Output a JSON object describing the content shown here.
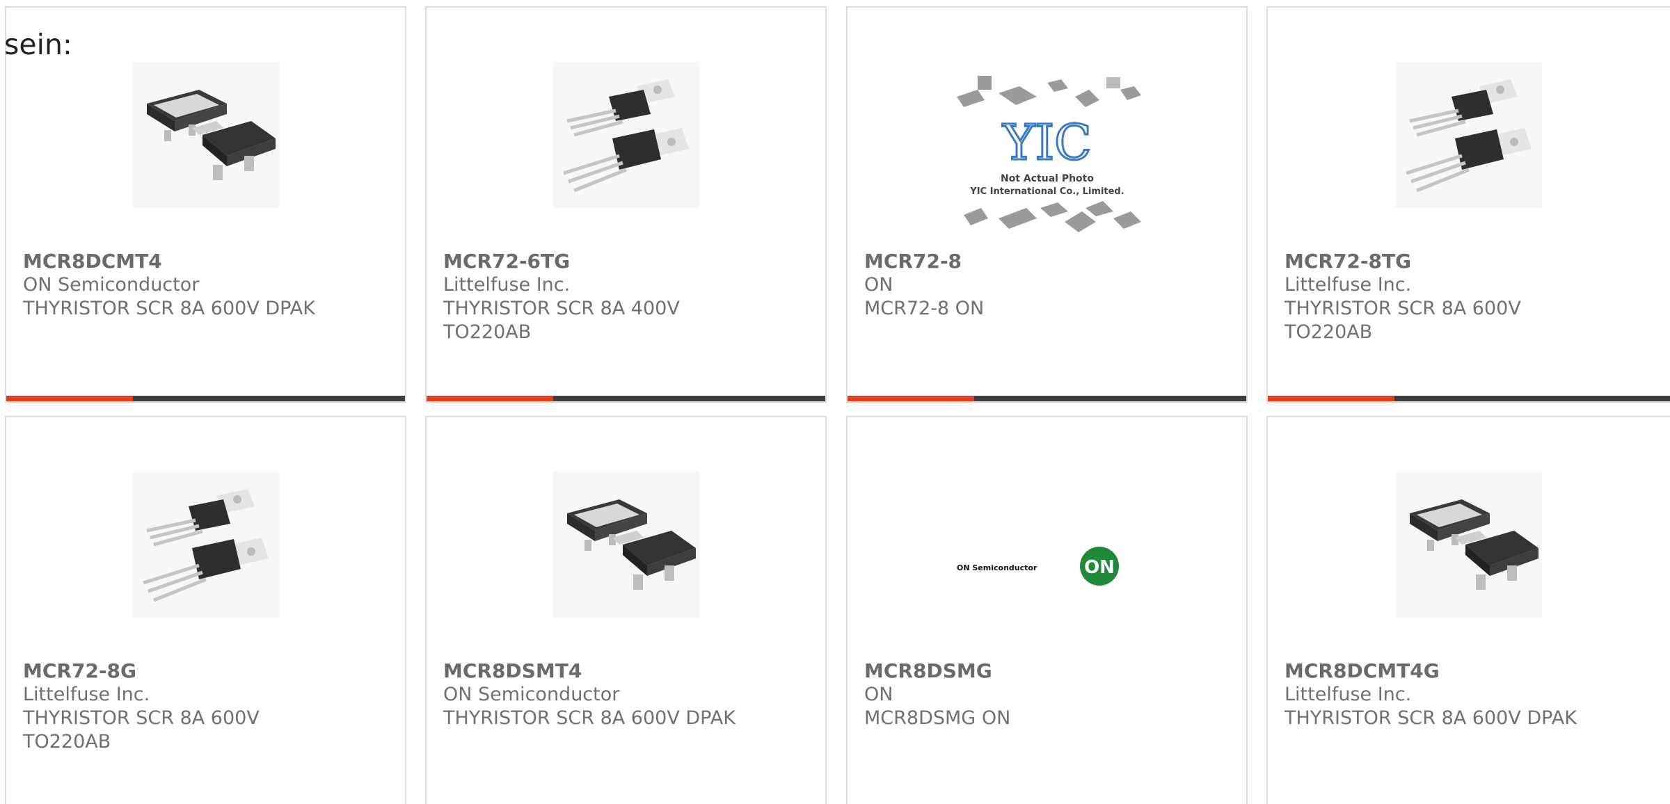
{
  "intro_text": "sein:",
  "accent_color": "#e0401c",
  "bar_color": "#3e3e3e",
  "products": [
    {
      "part_number": "MCR8DCMT4",
      "manufacturer": "ON Semiconductor",
      "description": "THYRISTOR SCR 8A 600V DPAK",
      "image": "dpak-package-icon"
    },
    {
      "part_number": "MCR72-6TG",
      "manufacturer": "Littelfuse Inc.",
      "description": "THYRISTOR SCR 8A 400V TO220AB",
      "image": "to220-package-icon"
    },
    {
      "part_number": "MCR72-8",
      "manufacturer": "ON",
      "description": "MCR72-8 ON",
      "image": "yic-not-actual-photo-icon",
      "image_caption_1": "Not Actual Photo",
      "image_caption_2": "YIC International Co., Limited.",
      "image_logo": "YIC"
    },
    {
      "part_number": "MCR72-8TG",
      "manufacturer": "Littelfuse Inc.",
      "description": "THYRISTOR SCR 8A 600V TO220AB",
      "image": "to220-package-icon"
    },
    {
      "part_number": "MCR72-8G",
      "manufacturer": "Littelfuse Inc.",
      "description": "THYRISTOR SCR 8A 600V TO220AB",
      "image": "to220-package-icon"
    },
    {
      "part_number": "MCR8DSMT4",
      "manufacturer": "ON Semiconductor",
      "description": "THYRISTOR SCR 8A 600V DPAK",
      "image": "dpak-package-icon"
    },
    {
      "part_number": "MCR8DSMG",
      "manufacturer": "ON",
      "description": "MCR8DSMG ON",
      "image": "on-semiconductor-logo-icon",
      "image_logo_text": "ON Semiconductor",
      "image_badge": "ON"
    },
    {
      "part_number": "MCR8DCMT4G",
      "manufacturer": "Littelfuse Inc.",
      "description": "THYRISTOR SCR 8A 600V DPAK",
      "image": "dpak-package-icon"
    }
  ]
}
